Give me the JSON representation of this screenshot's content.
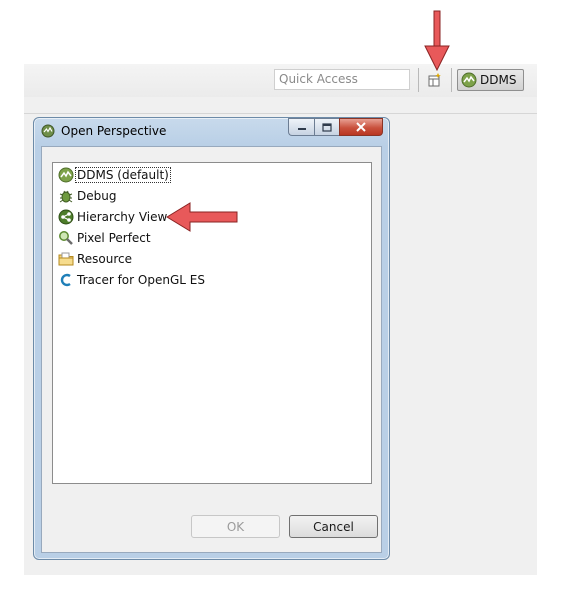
{
  "workbench": {
    "quick_access_placeholder": "Quick Access",
    "perspective_button_label": "DDMS",
    "open_perspective_tooltip_icon": "open-perspective-icon"
  },
  "dialog": {
    "title": "Open Perspective",
    "items": [
      {
        "label": "DDMS (default)",
        "icon": "ddms-icon",
        "selected": true
      },
      {
        "label": "Debug",
        "icon": "debug-bug-icon",
        "selected": false
      },
      {
        "label": "Hierarchy View",
        "icon": "hierarchy-view-icon",
        "selected": false
      },
      {
        "label": "Pixel Perfect",
        "icon": "magnifier-icon",
        "selected": false
      },
      {
        "label": "Resource",
        "icon": "resource-folder-icon",
        "selected": false
      },
      {
        "label": "Tracer for OpenGL ES",
        "icon": "tracer-icon",
        "selected": false
      }
    ],
    "ok_label": "OK",
    "cancel_label": "Cancel"
  },
  "colors": {
    "annotation_arrow": "#e8595a",
    "dialog_frame": "#b9cfe6",
    "close_button": "#c9513d"
  }
}
